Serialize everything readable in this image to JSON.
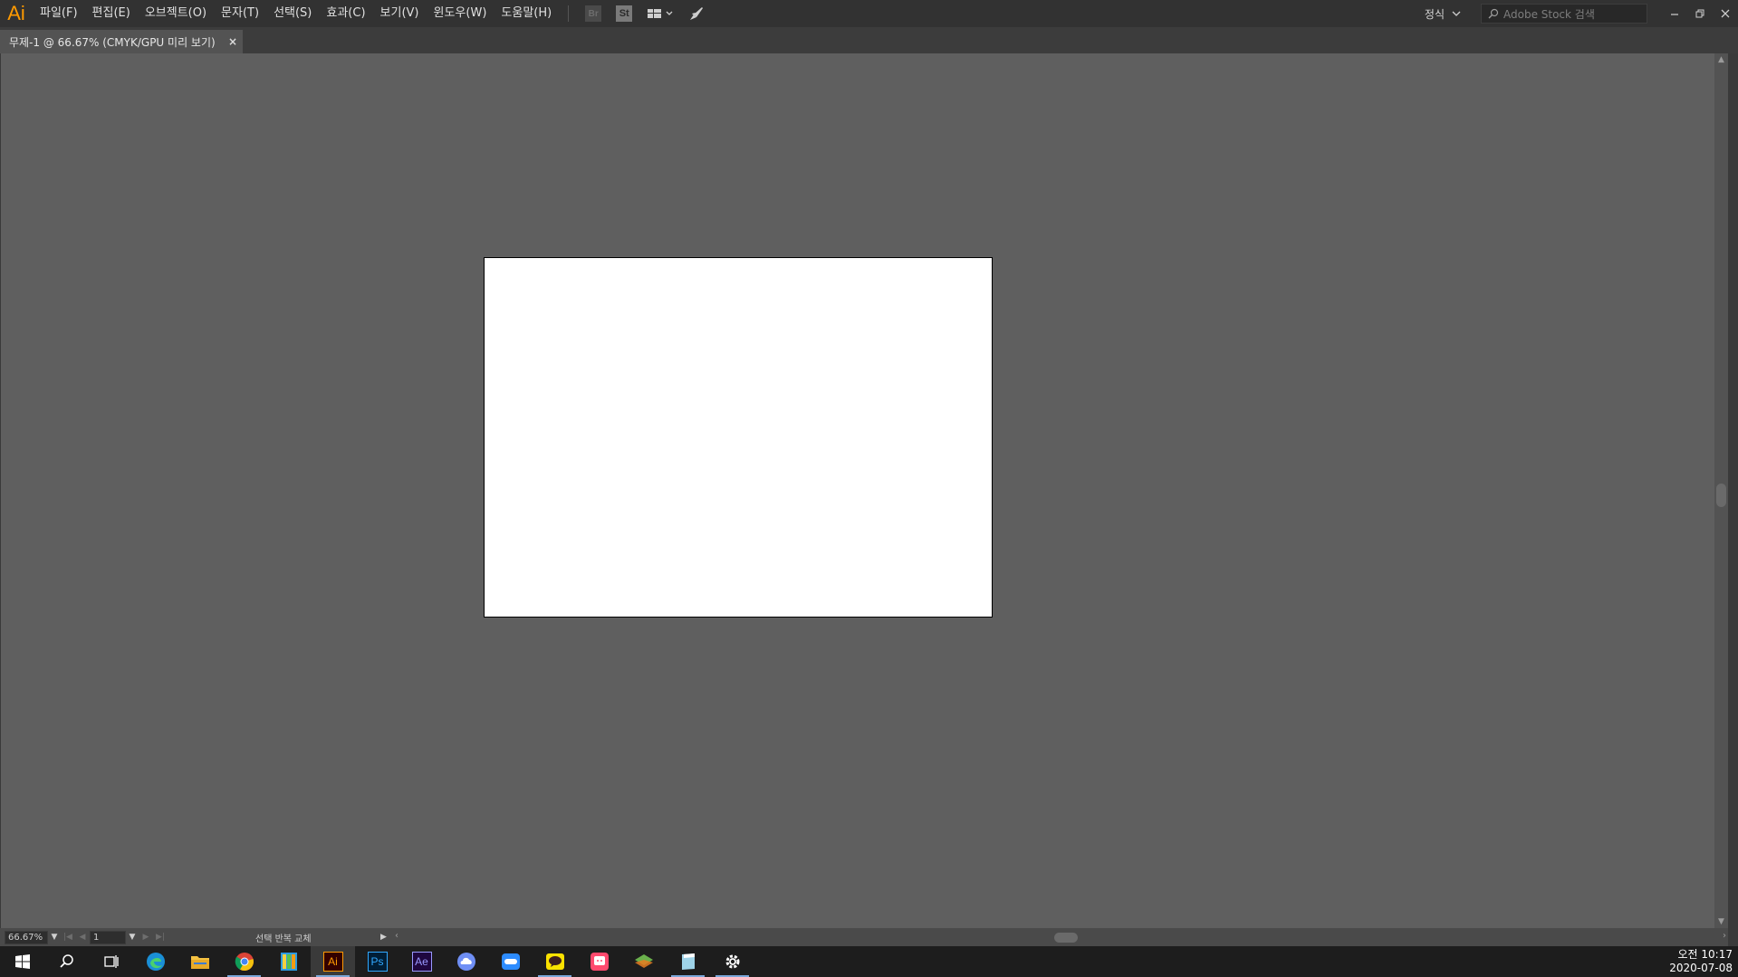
{
  "app": {
    "logo": "Ai"
  },
  "menu": [
    "파일(F)",
    "편집(E)",
    "오브젝트(O)",
    "문자(T)",
    "선택(S)",
    "효과(C)",
    "보기(V)",
    "윈도우(W)",
    "도움말(H)"
  ],
  "toolbar": {
    "bridge_label": "Br",
    "stock_label": "St"
  },
  "workspace": {
    "label": "정식"
  },
  "search": {
    "placeholder": "Adobe Stock 검색"
  },
  "document_tab": {
    "title": "무제-1 @ 66.67% (CMYK/GPU 미리 보기)",
    "close": "×"
  },
  "status": {
    "zoom": "66.67%",
    "artboard": "1",
    "tool_hint": "선택 반복 교체"
  },
  "taskbar": {
    "apps": [
      "start",
      "search",
      "task-view",
      "edge",
      "file-explorer",
      "chrome",
      "bandizip",
      "illustrator",
      "photoshop",
      "after-effects",
      "cloud-app",
      "zoom",
      "kakaotalk",
      "messenger",
      "layers-app",
      "notes-app",
      "settings"
    ],
    "ai_label": "Ai",
    "ps_label": "Ps",
    "ae_label": "Ae"
  },
  "clock": {
    "time": "오전 10:17",
    "date": "2020-07-08"
  },
  "colors": {
    "menubar": "#323232",
    "canvas": "#5f5f5f",
    "accent_ai": "#ff9a00",
    "taskbar": "#1d1d1d"
  }
}
